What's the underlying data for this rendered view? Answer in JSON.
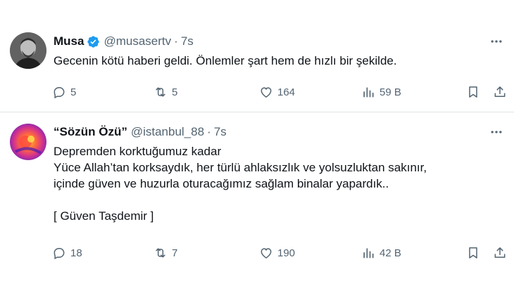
{
  "tweets": [
    {
      "name": "Musa",
      "verified": true,
      "handle": "@musasertv",
      "separator": "·",
      "time": "7s",
      "lines": [
        "Gecenin kötü haberi geldi. Önlemler şart hem de hızlı bir şekilde."
      ],
      "replies": "5",
      "retweets": "5",
      "likes": "164",
      "views": "59 B",
      "avatar_color": "#6b6b6b"
    },
    {
      "name": "“Sözün Özü”",
      "verified": false,
      "handle": "@istanbul_88",
      "separator": "·",
      "time": "7s",
      "lines": [
        "Depremden korktuğumuz kadar",
        "Yüce Allah’tan korksaydık, her türlü ahlaksızlık ve yolsuzluktan sakınır,",
        "içinde güven ve huzurla oturacağımız sağlam binalar yapardık..",
        "",
        "[ Güven Taşdemir ]"
      ],
      "replies": "18",
      "retweets": "7",
      "likes": "190",
      "views": "42 B",
      "avatar_color": "#7a2bd6"
    }
  ],
  "colors": {
    "text": "#0f1419",
    "secondary": "#536471",
    "verified_blue": "#1d9bf0",
    "divider": "#dfe3e6"
  },
  "icons": [
    "reply-icon",
    "retweet-icon",
    "like-icon",
    "views-icon",
    "bookmark-icon",
    "share-icon",
    "more-icon",
    "verified-icon"
  ]
}
